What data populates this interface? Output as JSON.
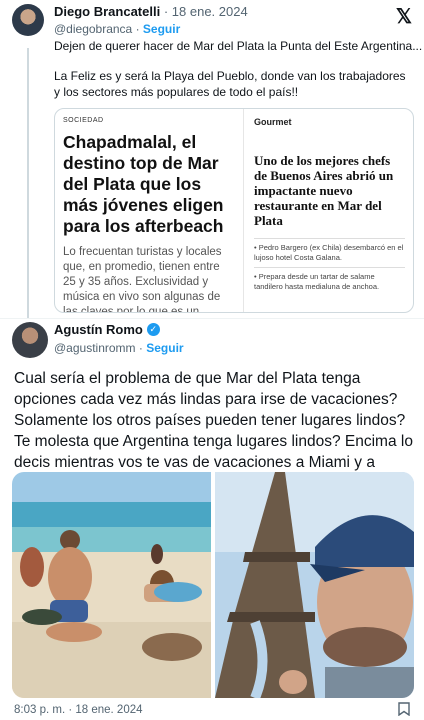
{
  "quoted": {
    "author_name": "Diego Brancatelli",
    "date": "18 ene. 2024",
    "separator": "·",
    "handle": "@diegobranca",
    "follow_label": "Seguir",
    "text_line1": "Dejen de querer hacer de Mar del Plata la Punta del Este Argentina...",
    "text_para2": "La Feliz es y será la Playa del Pueblo, donde van los trabajadores y los sectores más populares de todo el país!!",
    "article": {
      "section": "SOCIEDAD",
      "headline": "Chapadmalal, el destino top de Mar del Plata que los más jóvenes eligen para los afterbeach",
      "body": "Lo frecuentan turistas y locales que, en promedio, tienen entre 25 y 35 años. Exclusividad y música en vivo son algunas de las claves por lo que es un",
      "right_section": "Gourmet",
      "right_headline": "Uno de los mejores chefs de Buenos Aires abrió un impactante nuevo restaurante en Mar del Plata",
      "bullet1": "• Pedro Bargero (ex Chila) desembarcó en el lujoso hotel Costa Galana.",
      "bullet2": "• Prepara desde un tartar de salame tandilero hasta medialuna de anchoa."
    }
  },
  "main": {
    "author_name": "Agustín Romo",
    "handle": "@agustinromm",
    "separator": "·",
    "follow_label": "Seguir",
    "text": "Cual sería el problema de que Mar del Plata tenga opciones cada vez más lindas para irse de vacaciones? Solamente los otros países pueden tener lugares lindos? Te molesta que Argentina tenga lugares lindos? Encima lo decis mientras vos te vas de vacaciones a Miami y a Paris.",
    "timestamp": "8:03 p. m. · 18 ene. 2024"
  },
  "icons": {
    "logo": "x-logo",
    "verified": "verified-badge-icon",
    "bookmark": "bookmark-icon"
  },
  "colors": {
    "accent": "#1d9bf0",
    "text": "#0f1419",
    "secondary": "#536471"
  }
}
